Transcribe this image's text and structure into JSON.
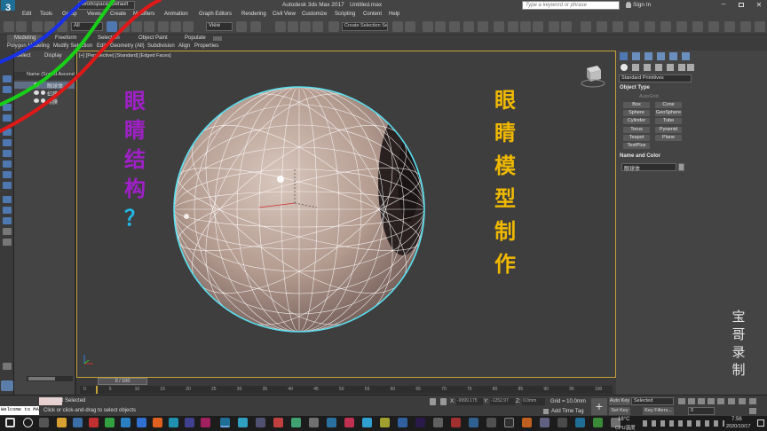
{
  "titlebar": {
    "workspace": "Workspace: Default",
    "app_title": "Autodesk 3ds Max 2017",
    "file_name": "Untitled.max",
    "search_placeholder": "Type a keyword or phrase",
    "sign_in": "Sign In"
  },
  "menu": [
    "Edit",
    "Tools",
    "Group",
    "Views",
    "Create",
    "Modifiers",
    "Animation",
    "Graph Editors",
    "Rendering",
    "Civil View",
    "Customize",
    "Scripting",
    "Content",
    "Help"
  ],
  "toolbar": {
    "filter_value": "All",
    "view_value": "View",
    "selection_set_placeholder": "Create Selection Se"
  },
  "ribbon": {
    "tabs": [
      "Modeling",
      "Freeform",
      "Selection",
      "Object Paint",
      "Populate"
    ],
    "subtabs": [
      "Polygon Modeling",
      "Modify Selection",
      "Edit",
      "Geometry (All)",
      "Subdivision",
      "Align",
      "Properties"
    ]
  },
  "scene_explorer": {
    "tabs": [
      "Select",
      "Display"
    ],
    "header": "Name (Sorted Ascending)",
    "items": [
      "眼球体",
      "虹膜",
      "角膜"
    ]
  },
  "viewport": {
    "label": "[+] [Perspective] [Standard] [Edged Faces]",
    "overlay_left": [
      "眼",
      "睛",
      "结",
      "构",
      "？"
    ],
    "overlay_right": [
      "眼",
      "睛",
      "模",
      "型",
      "制",
      "作"
    ]
  },
  "command_panel": {
    "category": "Standard Primitives",
    "object_type_title": "Object Type",
    "autogrid": "AutoGrid",
    "primitives": [
      "Box",
      "Cone",
      "Sphere",
      "GeoSphere",
      "Cylinder",
      "Tube",
      "Torus",
      "Pyramid",
      "Teapot",
      "Plane",
      "TextPlus"
    ],
    "name_color_title": "Name and Color",
    "name_value": "眼球体",
    "watermark": [
      "宝",
      "哥",
      "录",
      "制"
    ]
  },
  "timeline": {
    "frame_display": "0 / 100",
    "ticks": [
      "0",
      "5",
      "10",
      "15",
      "20",
      "25",
      "30",
      "35",
      "40",
      "45",
      "50",
      "55",
      "60",
      "65",
      "70",
      "75",
      "80",
      "85",
      "90",
      "95",
      "100"
    ]
  },
  "status": {
    "maxscript_text": "Welcome to MAX",
    "selection": "1 Object Selected",
    "prompt": "Click or click-and-drag to select objects",
    "x_label": "X:",
    "x_value": "-9999.175",
    "y_label": "Y:",
    "y_value": "-1252.97",
    "z_label": "Z:",
    "z_value": "0.0mm",
    "grid": "Grid = 10.0mm",
    "add_time_tag": "Add Time Tag",
    "auto_key": "Auto Key",
    "selected": "Selected",
    "set_key": "Set Key",
    "key_filters": "Key Filters...",
    "frame_value": "0"
  },
  "taskbar": {
    "weather": "18°C",
    "weather_desc": "CPU温度",
    "time": "7:56",
    "date": "2020/10/17"
  },
  "colors": {
    "accent_blue": "#4f78b0",
    "viewport_border": "#c8a23a",
    "overlay_purple": "#a020c8",
    "overlay_yellow": "#f0b800",
    "overlay_cyan": "#20b8e8",
    "wire_cyan": "#59e0f0",
    "autokey_red": "#b03030"
  }
}
